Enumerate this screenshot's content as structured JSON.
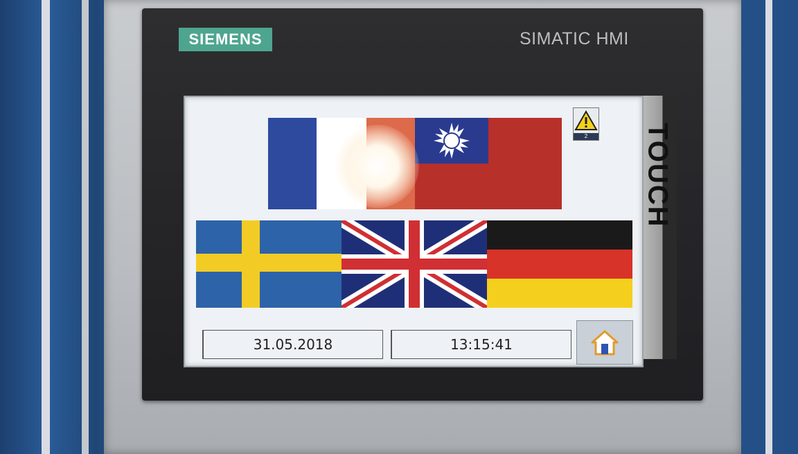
{
  "panel": {
    "brand_logo": "SIEMENS",
    "model_label": "SIMATIC HMI",
    "touch_label": "TOUCH"
  },
  "screen": {
    "flags": [
      {
        "name": "France",
        "icon": "flag-france-icon"
      },
      {
        "name": "Taiwan",
        "icon": "flag-taiwan-icon"
      },
      {
        "name": "Sweden",
        "icon": "flag-sweden-icon"
      },
      {
        "name": "United Kingdom",
        "icon": "flag-uk-icon"
      },
      {
        "name": "Germany",
        "icon": "flag-germany-icon"
      }
    ],
    "alarm_indicator": {
      "icon": "warning-icon",
      "count": "2"
    },
    "date": "31.05.2018",
    "time": "13:15:41",
    "home_button": {
      "icon": "home-icon"
    }
  },
  "colors": {
    "brand_teal": "#4ea58f",
    "bezel": "#262628",
    "screen_bg": "#eef1f5",
    "alarm_yellow": "#f2d21a"
  }
}
